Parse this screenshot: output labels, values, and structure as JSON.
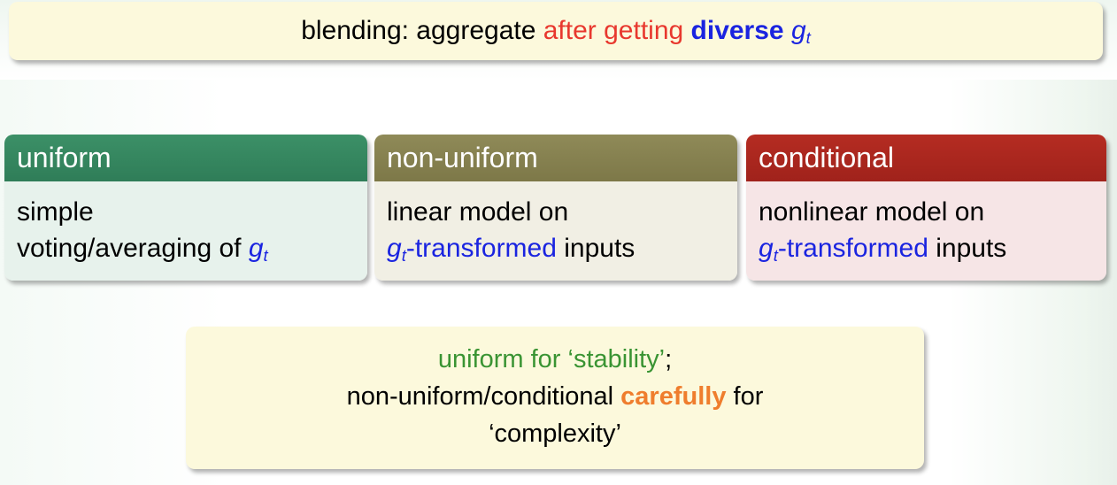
{
  "headline": {
    "prefix": "blending: aggregate ",
    "highlight": "after getting",
    "space": " ",
    "emphasis": "diverse",
    "symbol": "g",
    "subscript": "t"
  },
  "cards": [
    {
      "title": "uniform",
      "line1": "simple",
      "line2_text": "voting/averaging of ",
      "symbol": "g",
      "subscript": "t"
    },
    {
      "title": "non-uniform",
      "line1": "linear model on",
      "symbol": "g",
      "subscript": "t",
      "transformed": "-transformed",
      "inputs": " inputs"
    },
    {
      "title": "conditional",
      "line1": "nonlinear model on",
      "symbol": "g",
      "subscript": "t",
      "transformed": "-transformed",
      "inputs": " inputs"
    }
  ],
  "summary": {
    "line1": "uniform for ‘stability’",
    "line1_end": ";",
    "line2_start": "non-uniform/conditional ",
    "line2_emphasis": "carefully",
    "line2_end": " for",
    "line3": "‘complexity’"
  },
  "colors": {
    "uniform_header": "#2f7d58",
    "nonuniform_header": "#7d7848",
    "conditional_header": "#a0221b",
    "symbol_blue": "#1a24e0",
    "highlight_red": "#e8382e",
    "stability_green": "#3a9433",
    "carefully_orange": "#ef7d2d",
    "note_background": "#fcf9dc"
  }
}
